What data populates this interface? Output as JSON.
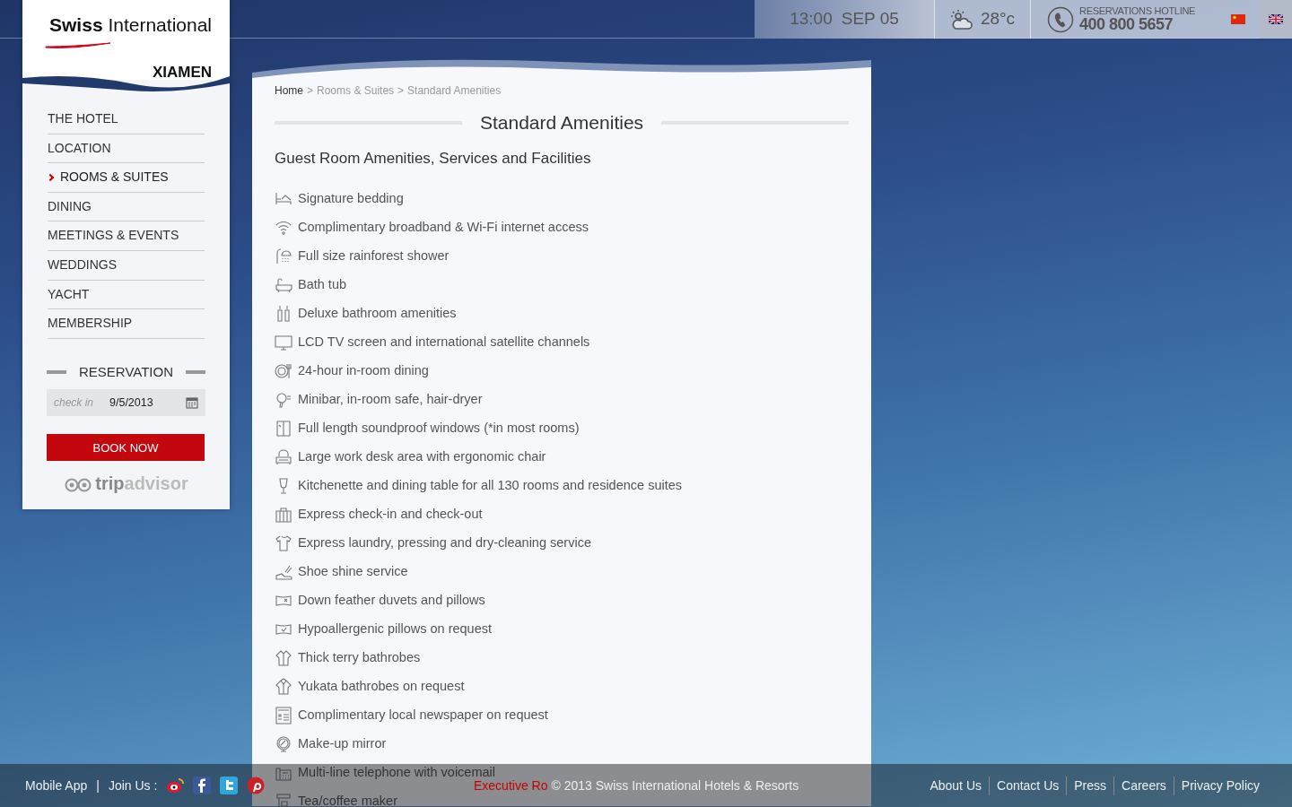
{
  "logo": {
    "brand": "**Swiss** International",
    "city": "XIAMEN"
  },
  "topbar": {
    "time": "13:00",
    "date": "SEP 05",
    "temperature": "28°c",
    "hotline_label": "RESERVATIONS HOTLINE",
    "hotline_number": "400 800 5657",
    "languages": [
      {
        "kind": "cn",
        "selected": false
      },
      {
        "kind": "uk",
        "selected": true
      }
    ]
  },
  "nav": [
    {
      "label": "THE HOTEL",
      "selected": false
    },
    {
      "label": "LOCATION",
      "selected": false
    },
    {
      "label": "ROOMS & SUITES",
      "selected": true
    },
    {
      "label": "DINING",
      "selected": false
    },
    {
      "label": "MEETINGS & EVENTS",
      "selected": false
    },
    {
      "label": "WEDDINGS",
      "selected": false
    },
    {
      "label": "YACHT",
      "selected": false
    },
    {
      "label": "MEMBERSHIP",
      "selected": false
    }
  ],
  "reservation": {
    "title": "RESERVATION",
    "checkin_placeholder": "check in",
    "checkin_value": "9/5/2013",
    "button": "BOOK NOW",
    "tripadvisor": "**trip**advisor"
  },
  "breadcrumb": [
    "Home",
    "Rooms & Suites",
    "Standard Amenities"
  ],
  "breadcrumb_separator": ">",
  "page_title": "Standard Amenities",
  "section_title": "Guest Room Amenities, Services and Facilities",
  "amenities": [
    "Signature bedding",
    "Complimentary broadband & Wi-Fi internet access",
    "Full size rainforest shower",
    "Bath tub",
    "Deluxe bathroom amenities",
    "LCD TV screen and international satellite channels",
    "24-hour in-room dining",
    "Minibar, in-room safe, hair-dryer",
    "Full length soundproof windows (*in most rooms)",
    "Large work desk area with ergonomic chair",
    "Kitchenette and dining table for all 130 rooms and residence suites",
    "Express check-in and check-out",
    "Express laundry, pressing and dry-cleaning service",
    "Shoe shine service",
    "Down feather duvets and pillows",
    "Hypoallergenic pillows on request",
    "Thick terry bathrobes",
    "Yukata bathrobes on request",
    "Complimentary local newspaper on request",
    "Make-up mirror",
    "Multi-line telephone with voicemail",
    "Tea/coffee maker"
  ],
  "footer": {
    "mobile_app": "Mobile App",
    "separator": "|",
    "join_us": "Join Us :",
    "partial_text": "Executive Ro",
    "copyright": "© 2013 Swiss International Hotels & Resorts",
    "links": [
      "About Us",
      "Contact Us",
      "Press",
      "Careers",
      "Privacy Policy"
    ]
  }
}
